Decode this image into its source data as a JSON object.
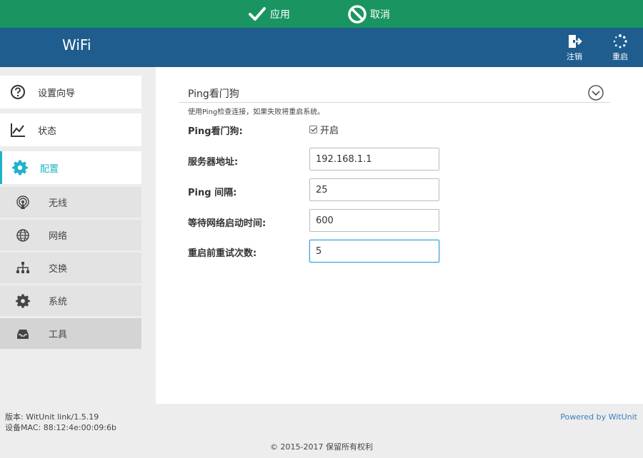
{
  "actionbar": {
    "apply_label": "应用",
    "cancel_label": "取消",
    "color": "#1a9461"
  },
  "header": {
    "brand": "WiFi",
    "logout_label": "注销",
    "reboot_label": "重启",
    "color": "#1f5d8e"
  },
  "sidebar": {
    "items": [
      {
        "label": "设置向导",
        "icon": "help-circle-icon"
      },
      {
        "label": "状态",
        "icon": "chart-icon"
      },
      {
        "label": "配置",
        "icon": "gear-icon",
        "active": true
      }
    ],
    "subitems": [
      {
        "label": "无线",
        "icon": "wireless-icon"
      },
      {
        "label": "网络",
        "icon": "globe-icon"
      },
      {
        "label": "交换",
        "icon": "network-tree-icon"
      },
      {
        "label": "系统",
        "icon": "gear-icon"
      },
      {
        "label": "工具",
        "icon": "tray-icon",
        "selected": true
      }
    ]
  },
  "main": {
    "section_title": "Ping看门狗",
    "description": "使用Ping检查连接，如果失败将重启系统。",
    "fields": {
      "watchdog_label": "Ping看门狗:",
      "watchdog_enabled_label": "开启",
      "watchdog_enabled": true,
      "server_label": "服务器地址:",
      "server_value": "192.168.1.1",
      "interval_label": "Ping 间隔:",
      "interval_value": "25",
      "wait_label": "等待网络启动时间:",
      "wait_value": "600",
      "retries_label": "重启前重试次数:",
      "retries_value": "5"
    }
  },
  "footer": {
    "version": "版本: WitUnit link/1.5.19",
    "mac": "设备MAC: 88:12:4e:00:09:6b",
    "powered_by": "Powered by WitUnit",
    "copyright": "© 2015-2017  保留所有权利"
  }
}
